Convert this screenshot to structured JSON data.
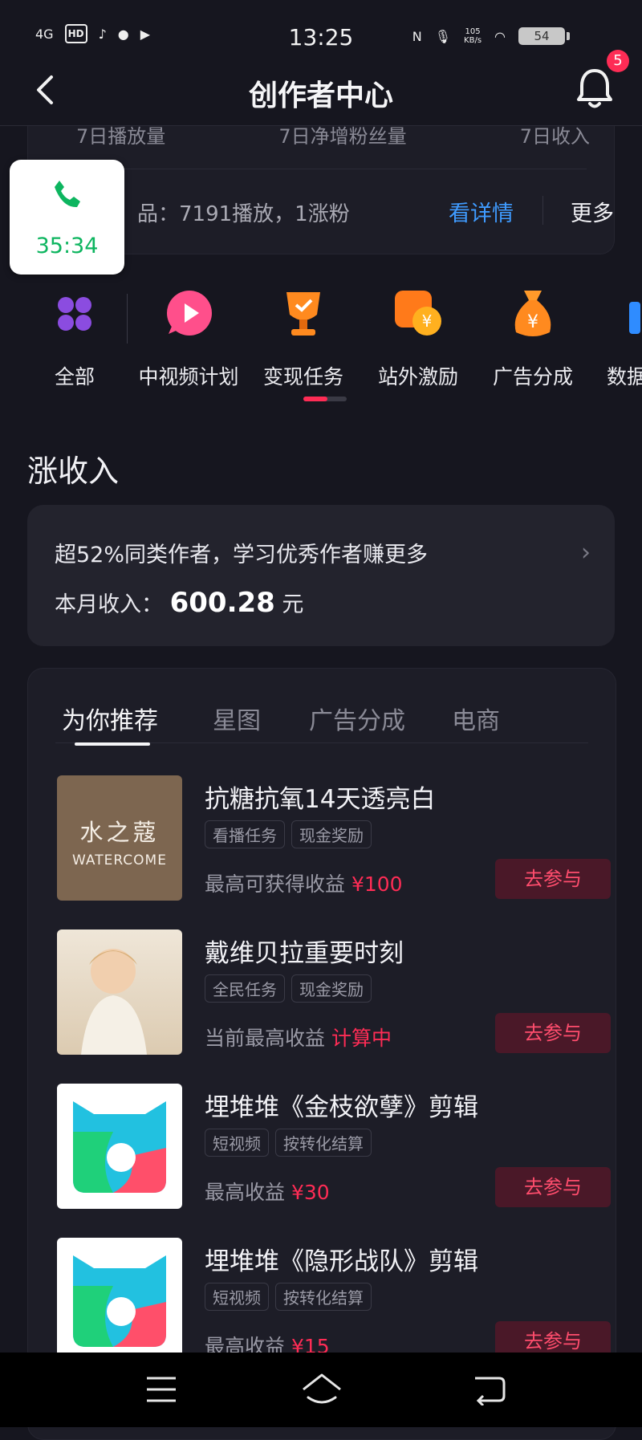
{
  "status_bar": {
    "network": "4G",
    "hd_label": "HD",
    "time": "13:25",
    "net_speed_value": "105",
    "net_speed_unit": "KB/s",
    "battery": "54"
  },
  "header": {
    "title": "创作者中心",
    "notification_count": "5"
  },
  "stats": {
    "labels": [
      "7日播放量",
      "7日净增粉丝量",
      "7日收入"
    ],
    "work_line": "品：7191播放，1涨粉",
    "detail_link": "看详情",
    "more_link": "更多"
  },
  "call_widget": {
    "timer": "35:34"
  },
  "categories": [
    {
      "label": "全部",
      "icon": "grid-icon"
    },
    {
      "label": "中视频计划",
      "icon": "play-bubble-icon"
    },
    {
      "label": "变现任务",
      "icon": "trophy-icon"
    },
    {
      "label": "站外激励",
      "icon": "coin-video-icon"
    },
    {
      "label": "广告分成",
      "icon": "money-bag-icon"
    },
    {
      "label": "数据",
      "icon": "data-icon"
    }
  ],
  "section": {
    "title": "涨收入"
  },
  "income": {
    "tip": "超52%同类作者，学习优秀作者赚更多",
    "label": "本月收入：",
    "amount": "600.28",
    "unit": "元"
  },
  "tabs": [
    "为你推荐",
    "星图",
    "广告分成",
    "电商"
  ],
  "tasks": [
    {
      "title": "抗糖抗氧14天透亮白",
      "tags": [
        "看播任务",
        "现金奖励"
      ],
      "earn_label": "最高可获得收益 ",
      "earn_value": "¥100",
      "button": "去参与",
      "thumb_cn": "水之蔻",
      "thumb_en": "WATERCOME"
    },
    {
      "title": "戴维贝拉重要时刻",
      "tags": [
        "全民任务",
        "现金奖励"
      ],
      "earn_label": "当前最高收益 ",
      "earn_value": "计算中",
      "button": "去参与"
    },
    {
      "title": "埋堆堆《金枝欲孽》剪辑",
      "tags": [
        "短视频",
        "按转化结算"
      ],
      "earn_label": "最高收益 ",
      "earn_value": "¥30",
      "button": "去参与"
    },
    {
      "title": "埋堆堆《隐形战队》剪辑",
      "tags": [
        "短视频",
        "按转化结算"
      ],
      "earn_label": "最高收益 ",
      "earn_value": "¥15",
      "button": "去参与"
    }
  ],
  "colors": {
    "accent": "#fe2c55",
    "link": "#3f9bff",
    "background": "#16161f"
  }
}
